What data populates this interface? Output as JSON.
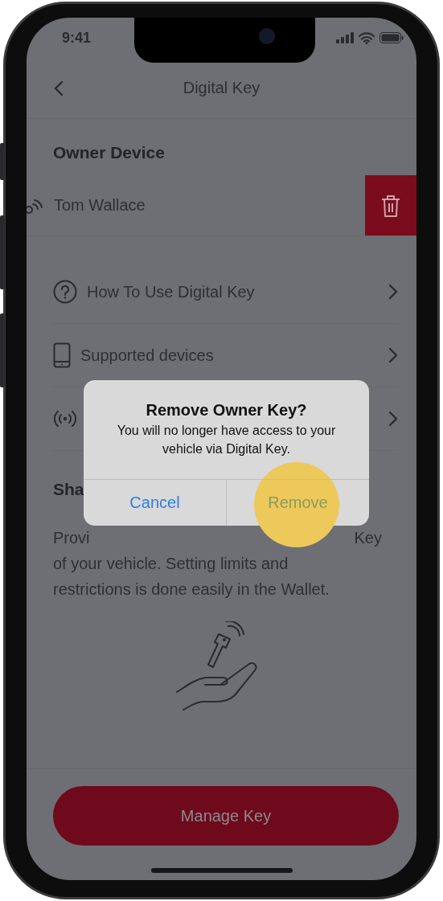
{
  "status_bar": {
    "time": "9:41"
  },
  "header": {
    "title": "Digital Key"
  },
  "owner_section": {
    "title": "Owner Device",
    "device": {
      "name": "Tom Wallace",
      "swiped": true
    }
  },
  "menu_items": [
    {
      "kind": "help",
      "label": "How To Use Digital Key"
    },
    {
      "kind": "phone",
      "label": "Supported devices"
    },
    {
      "kind": "signal"
    }
  ],
  "share_section": {
    "title": "Sha",
    "covered_line_parts": [
      "Provi",
      "Key"
    ],
    "description": "of your vehicle. Setting limits and\nrestrictions is done easily in the Wallet."
  },
  "primary_button": {
    "label": "Manage Key"
  },
  "dialog": {
    "title": "Remove Owner Key?",
    "message": "You will no longer have access to your vehicle via Digital Key.",
    "buttons": [
      {
        "label": "Cancel",
        "highlighted": false
      },
      {
        "label": "Remove",
        "highlighted": true
      }
    ]
  }
}
